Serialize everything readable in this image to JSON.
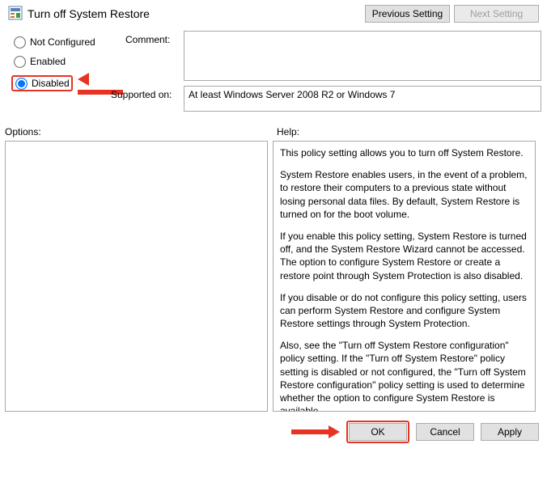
{
  "title": "Turn off System Restore",
  "nav": {
    "prev": "Previous Setting",
    "next": "Next Setting"
  },
  "radios": {
    "not_configured": "Not Configured",
    "enabled": "Enabled",
    "disabled": "Disabled",
    "selected": "disabled"
  },
  "labels": {
    "comment": "Comment:",
    "supported": "Supported on:",
    "options": "Options:",
    "help": "Help:"
  },
  "supported_text": "At least Windows Server 2008 R2 or Windows 7",
  "comment_text": "",
  "help_paragraphs": [
    "This policy setting allows you to turn off System Restore.",
    "System Restore enables users, in the event of a problem, to restore their computers to a previous state without losing personal data files. By default, System Restore is turned on for the boot volume.",
    "If you enable this policy setting, System Restore is turned off, and the System Restore Wizard cannot be accessed. The option to configure System Restore or create a restore point through System Protection is also disabled.",
    "If you disable or do not configure this policy setting, users can perform System Restore and configure System Restore settings through System Protection.",
    "Also, see the \"Turn off System Restore configuration\" policy setting. If the \"Turn off System Restore\" policy setting is disabled or not configured, the \"Turn off System Restore configuration\" policy setting is used to determine whether the option to configure System Restore is available."
  ],
  "buttons": {
    "ok": "OK",
    "cancel": "Cancel",
    "apply": "Apply"
  }
}
